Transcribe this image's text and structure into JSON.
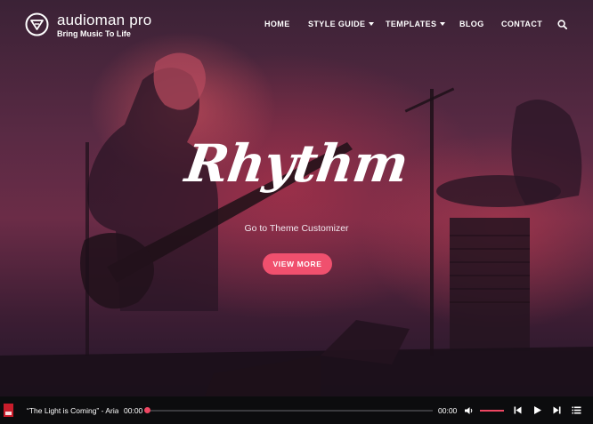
{
  "brand": {
    "name": "audioman pro",
    "tagline": "Bring Music To Life"
  },
  "nav": {
    "items": [
      {
        "label": "HOME",
        "has_dropdown": false
      },
      {
        "label": "STYLE GUIDE",
        "has_dropdown": true
      },
      {
        "label": "TEMPLATES",
        "has_dropdown": true
      },
      {
        "label": "BLOG",
        "has_dropdown": false
      },
      {
        "label": "CONTACT",
        "has_dropdown": false
      }
    ],
    "search_icon": "search-icon"
  },
  "hero": {
    "title": "Rhythm",
    "subtitle": "Go to Theme Customizer",
    "cta_label": "VIEW MORE"
  },
  "player": {
    "track_title": "“The Light is Coming” - Arian…",
    "current_time": "00:00",
    "duration": "00:00",
    "progress": 0,
    "volume": 1,
    "icons": [
      "previous-icon",
      "play-icon",
      "next-icon",
      "playlist-icon",
      "volume-icon"
    ]
  },
  "colors": {
    "accent": "#f0506e",
    "player_bg": "#0c0c0e",
    "hero_tint": "#6b2c47"
  }
}
